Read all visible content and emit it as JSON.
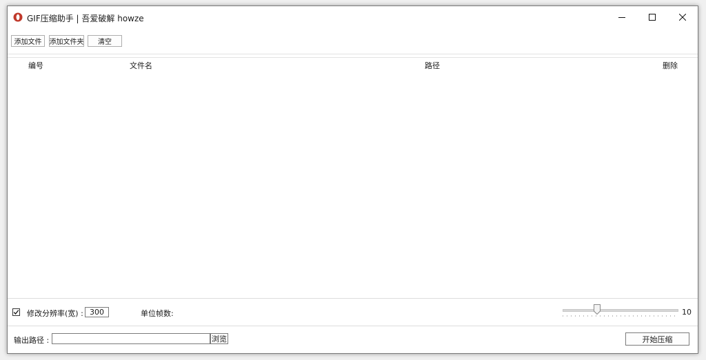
{
  "window": {
    "title": "GIF压缩助手 | 吾爱破解 howze",
    "accent_color": "#c0392b"
  },
  "toolbar": {
    "add_file_label": "添加文件",
    "add_folder_label": "添加文件夹",
    "clear_label": "清空"
  },
  "list": {
    "columns": [
      "编号",
      "文件名",
      "路径",
      "删除"
    ],
    "rows": []
  },
  "options": {
    "resize_checked": true,
    "resize_label": "修改分辨率(宽) :",
    "width_value": "300",
    "frame_unit_label": "单位帧数:",
    "slider_value": "10",
    "slider_fraction": 0.3
  },
  "output": {
    "path_label": "输出路径 :",
    "path_value": "",
    "browse_label": "浏览",
    "start_label": "开始压缩"
  }
}
